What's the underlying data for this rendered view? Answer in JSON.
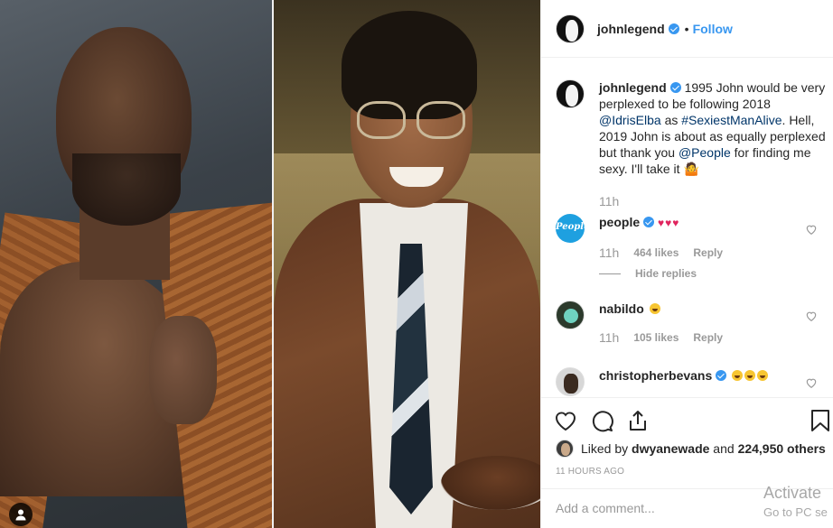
{
  "post": {
    "username": "johnlegend",
    "dot": "•",
    "follow_label": "Follow"
  },
  "caption": {
    "username": "johnlegend",
    "text_1": "1995 John would be very perplexed to be following 2018 ",
    "mention_1": "@IdrisElba",
    "text_2": " as ",
    "hashtag": "#SexiestManAlive",
    "text_3": ". Hell, 2019 John is about as equally perplexed but thank you ",
    "mention_2": "@People",
    "text_4": " for finding me sexy. I'll take it 🤷",
    "time": "11h"
  },
  "comments": [
    {
      "username": "people",
      "avatar_text": "People",
      "text": "♥♥♥",
      "time": "11h",
      "likes": "464 likes",
      "reply_label": "Reply",
      "hide_replies_label": "Hide replies"
    },
    {
      "username": "nabildo",
      "time": "11h",
      "likes": "105 likes",
      "reply_label": "Reply"
    },
    {
      "username": "christopherbevans"
    }
  ],
  "liked_by": {
    "prefix": "Liked by ",
    "user": "dwyanewade",
    "middle": " and ",
    "others": "224,950 others"
  },
  "timestamp": "11 HOURS AGO",
  "add_comment": {
    "placeholder": "Add a comment..."
  },
  "watermark": {
    "line1": "Activate",
    "line2": "Go to PC se"
  },
  "colors": {
    "accent": "#3897f0",
    "link": "#003569",
    "muted": "#999999",
    "heart": "#e0245e"
  },
  "icons": [
    "person-tag-icon",
    "verified-icon",
    "heart-icon",
    "comment-icon",
    "share-icon",
    "bookmark-icon"
  ]
}
